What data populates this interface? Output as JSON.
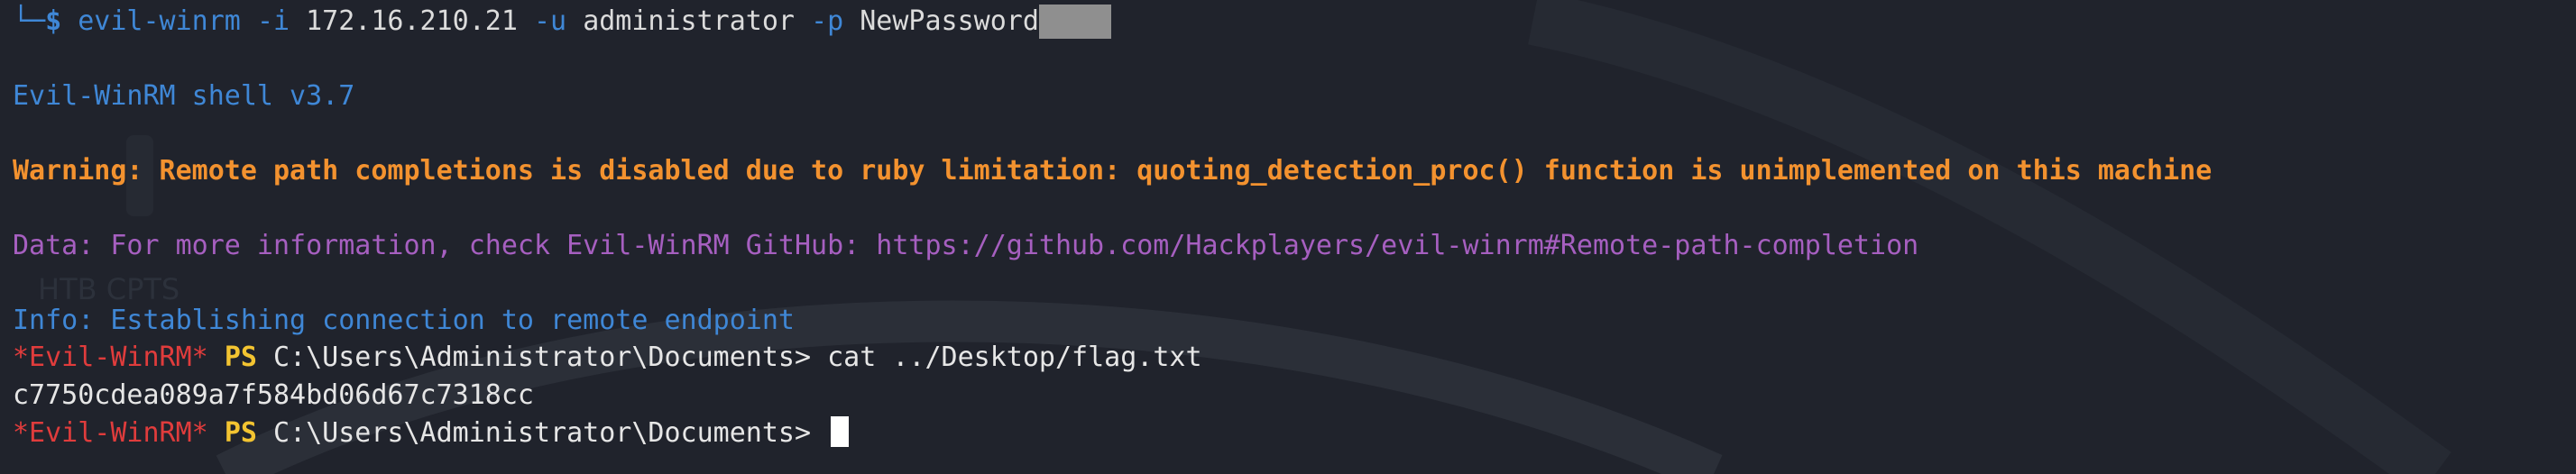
{
  "prompt": {
    "corner": "└─",
    "dollar": "$",
    "command": "evil-winrm",
    "flag_i": "-i",
    "ip": "172.16.210.21",
    "flag_u": "-u",
    "user": "administrator",
    "flag_p": "-p",
    "password_visible": "NewPassword"
  },
  "output": {
    "version": "Evil-WinRM shell v3.7",
    "warning": "Warning: Remote path completions is disabled due to ruby limitation: quoting_detection_proc() function is unimplemented on this machine",
    "data_line": "Data: For more information, check Evil-WinRM GitHub: https://github.com/Hackplayers/evil-winrm#Remote-path-completion",
    "info": "Info: Establishing connection to remote endpoint",
    "flag_value": "c7750cdea089a7f584bd06d67c7318cc"
  },
  "shell": {
    "evil_tag": "*Evil-WinRM*",
    "ps_tag": "PS",
    "cwd": "C:\\Users\\Administrator\\Documents>",
    "command1": "cat ../Desktop/flag.txt"
  },
  "watermark": {
    "text": "HTB CPTS"
  },
  "colors": {
    "background": "#20232c",
    "blue": "#3f87d6",
    "orange": "#f3922f",
    "purple": "#a65fc0",
    "red": "#e03c3c",
    "yellow": "#f3c431"
  }
}
